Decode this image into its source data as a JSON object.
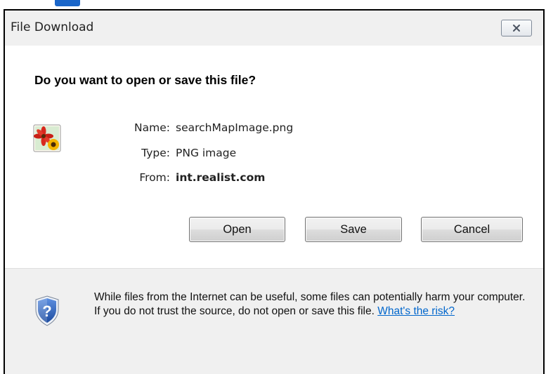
{
  "window": {
    "title": "File Download",
    "close_icon": "close-icon"
  },
  "dialog": {
    "question": "Do you want to open or save this file?",
    "file_icon": "png-image-file-icon",
    "fields": {
      "name_label": "Name:",
      "name_value": "searchMapImage.png",
      "type_label": "Type:",
      "type_value": "PNG image",
      "from_label": "From:",
      "from_value": "int.realist.com"
    },
    "buttons": {
      "open_label": "Open",
      "save_label": "Save",
      "cancel_label": "Cancel"
    }
  },
  "footer": {
    "shield_icon": "security-shield-icon",
    "warning_text": "While files from the Internet can be useful, some files can potentially harm your computer. If you do not trust the source, do not open or save this file.",
    "risk_link": "What's the risk?"
  },
  "colors": {
    "accent_link": "#0066cc",
    "shield_blue": "#2a5db0",
    "dialog_background": "#f0f0f0"
  }
}
